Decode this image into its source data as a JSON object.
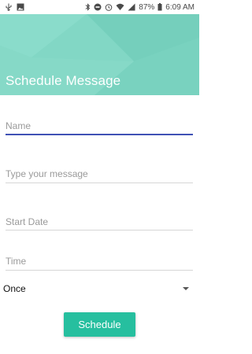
{
  "status_bar": {
    "battery": "87%",
    "time": "6:09 AM",
    "left_icons": [
      "usb-icon",
      "image-icon"
    ],
    "right_icons": [
      "bluetooth-icon",
      "dnd-icon",
      "alarm-icon",
      "wifi-icon",
      "signal-icon",
      "battery-icon"
    ]
  },
  "header": {
    "title": "Schedule Message",
    "color": "#7fd6c4"
  },
  "form": {
    "name_placeholder": "Name",
    "message_placeholder": "Type your message",
    "start_date_placeholder": "Start Date",
    "time_placeholder": "Time",
    "repeat_value": "Once",
    "active_line_color": "#3f51b5"
  },
  "actions": {
    "schedule_label": "Schedule",
    "button_color": "#26bf9f"
  }
}
